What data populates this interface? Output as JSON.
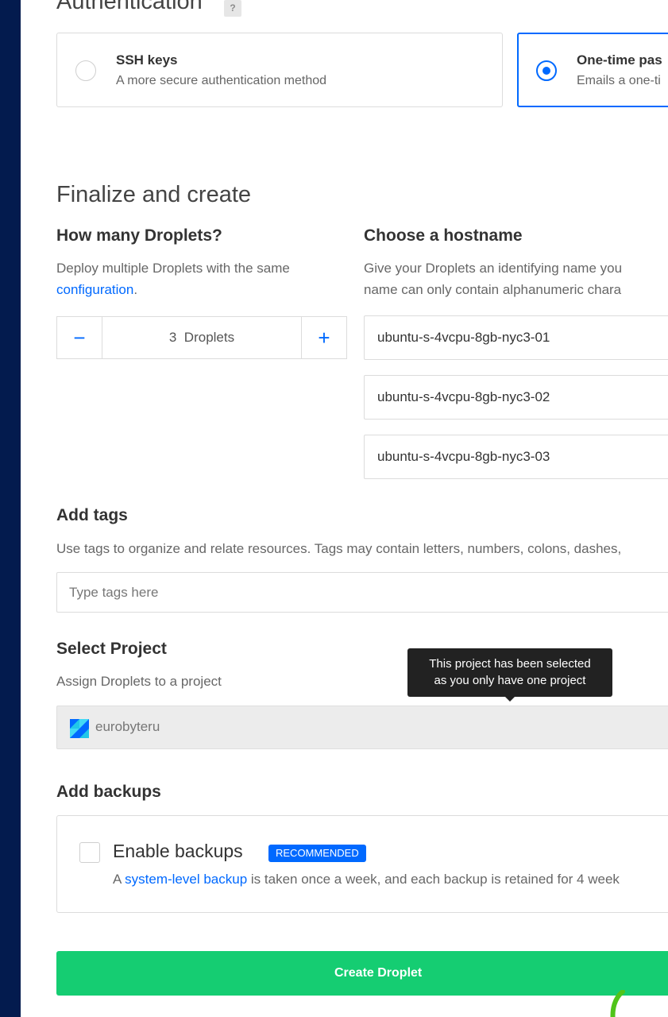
{
  "authentication": {
    "title": "Authentication",
    "help": "?",
    "options": [
      {
        "title": "SSH keys",
        "description": "A more secure authentication method",
        "selected": false
      },
      {
        "title": "One-time pas",
        "description": "Emails a one-ti",
        "selected": true
      }
    ]
  },
  "finalize": {
    "title": "Finalize and create",
    "droplets": {
      "heading": "How many Droplets?",
      "desc_text": "Deploy multiple Droplets with the same",
      "desc_link": "configuration",
      "desc_end": ".",
      "minus": "−",
      "plus": "+",
      "count_value": "3",
      "count_unit": "Droplets"
    },
    "hostname": {
      "heading": "Choose a hostname",
      "desc_line1": "Give your Droplets an identifying name you",
      "desc_line2": "name can only contain alphanumeric chara",
      "values": [
        "ubuntu-s-4vcpu-8gb-nyc3-01",
        "ubuntu-s-4vcpu-8gb-nyc3-02",
        "ubuntu-s-4vcpu-8gb-nyc3-03"
      ]
    }
  },
  "tags": {
    "heading": "Add tags",
    "description": "Use tags to organize and relate resources. Tags may contain letters, numbers, colons, dashes,",
    "placeholder": "Type tags here"
  },
  "project": {
    "heading": "Select Project",
    "description": "Assign Droplets to a project",
    "tooltip_line1": "This project has been selected",
    "tooltip_line2": "as you only have one project",
    "selected": "eurobyteru"
  },
  "backups": {
    "heading": "Add backups",
    "checkbox_label": "Enable backups",
    "badge": "RECOMMENDED",
    "desc_start": "A",
    "desc_link": "system-level backup",
    "desc_end": "is taken once a week, and each backup is retained for 4 week",
    "checked": false
  },
  "create_button": "Create Droplet",
  "colors": {
    "primary": "#0069ff",
    "success": "#15cd72",
    "sidebar": "#031b4e",
    "tooltip": "#222222"
  }
}
